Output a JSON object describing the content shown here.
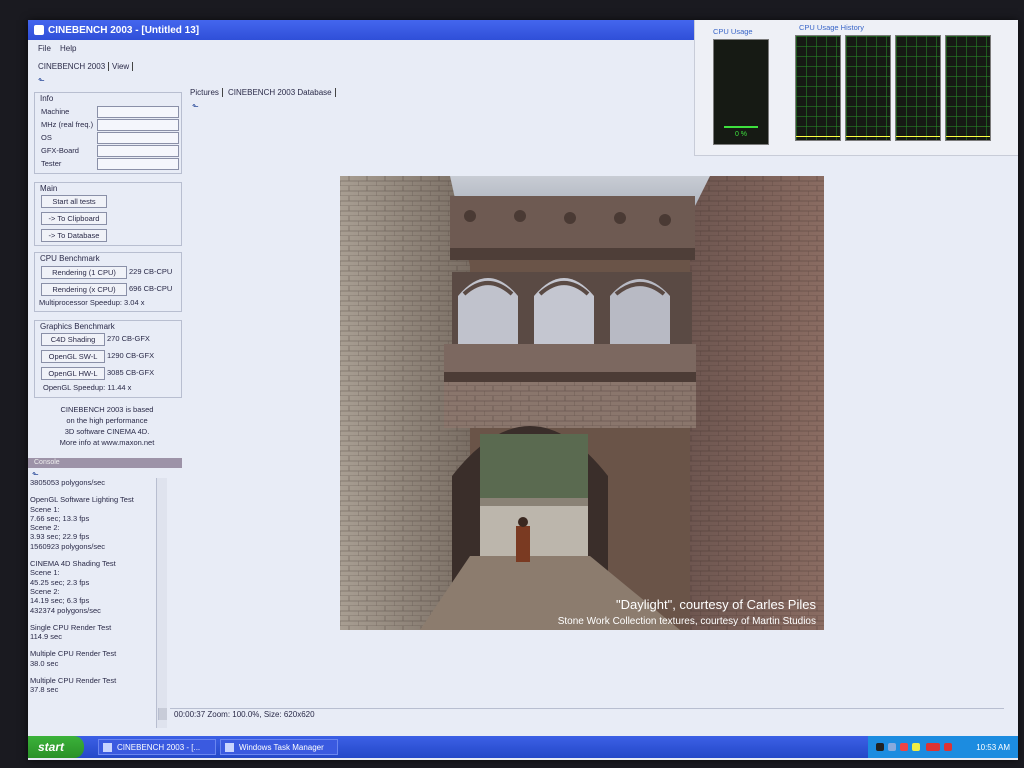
{
  "window": {
    "title": "CINEBENCH 2003 - [Untitled 13]"
  },
  "menu": {
    "file": "File",
    "help": "Help"
  },
  "app_tabs": [
    "CINEBENCH 2003",
    "View"
  ],
  "info": {
    "title": "Info",
    "fields": [
      "Machine",
      "MHz (real freq.)",
      "OS",
      "GFX-Board",
      "Tester"
    ]
  },
  "main": {
    "title": "Main",
    "start_label": "Start all tests",
    "clipboard_label": "-> To Clipboard",
    "database_label": "-> To Database"
  },
  "cpu_benchmark": {
    "title": "CPU Benchmark",
    "rendering_1cpu_label": "Rendering (1 CPU)",
    "rendering_1cpu_score": "229 CB-CPU",
    "rendering_xcpu_label": "Rendering (x CPU)",
    "rendering_xcpu_score": "696 CB-CPU",
    "speedup": "Multiprocessor Speedup:  3.04 x"
  },
  "graphics_benchmark": {
    "title": "Graphics Benchmark",
    "c4d_label": "C4D Shading",
    "c4d_score": "270 CB-GFX",
    "swl_label": "OpenGL SW-L",
    "swl_score": "1290 CB-GFX",
    "hwl_label": "OpenGL HW-L",
    "hwl_score": "3085 CB-GFX",
    "speedup": "OpenGL Speedup:  11.44 x"
  },
  "about": [
    "CINEBENCH 2003 is based",
    "on the high performance",
    "3D software CINEMA 4D.",
    "More info at www.maxon.net"
  ],
  "console": {
    "title": "Console",
    "lines": [
      "3805053 polygons/sec",
      "",
      "OpenGL Software Lighting Test",
      "Scene 1:",
      "7.66 sec; 13.3 fps",
      "Scene 2:",
      "3.93 sec; 22.9 fps",
      "1560923 polygons/sec",
      "",
      "CINEMA 4D Shading Test",
      "Scene 1:",
      "45.25 sec; 2.3 fps",
      "Scene 2:",
      "14.19 sec; 6.3 fps",
      "432374 polygons/sec",
      "",
      "Single CPU Render Test",
      "114.9 sec",
      "",
      "Multiple CPU Render Test",
      "38.0 sec",
      "",
      "Multiple CPU Render Test",
      "37.8 sec"
    ]
  },
  "view_tabs": [
    "Pictures",
    "CINEBENCH 2003 Database"
  ],
  "render": {
    "caption": "\"Daylight\", courtesy of Carles Piles",
    "credit": "Stone Work Collection textures, courtesy of Martin Studios"
  },
  "status": "00:00:37  Zoom: 100.0%, Size: 620x620",
  "task_manager": {
    "cpu_usage_label": "CPU Usage",
    "history_label": "CPU Usage History",
    "cpu_percent": "0 %",
    "cpu_fraction": 0.03
  },
  "taskbar": {
    "start": "start",
    "buttons": [
      "CINEBENCH 2003 - [...",
      "Windows Task Manager"
    ],
    "clock": "10:53 AM"
  },
  "colors": {
    "titlebar": "#3557e0",
    "taskbar": "#2f52d8",
    "start": "#34a834",
    "cpu_graph": "#3ee03e"
  }
}
